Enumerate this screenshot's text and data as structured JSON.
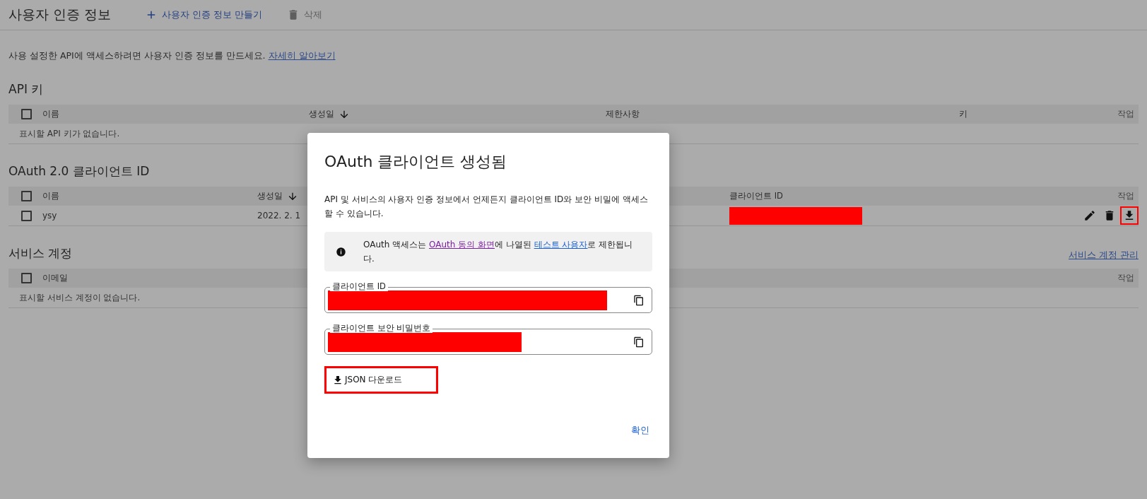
{
  "page": {
    "title": "사용자 인증 정보"
  },
  "toolbar": [
    {
      "kind": "create",
      "label": "사용자 인증 정보 만들기",
      "disabled": false
    },
    {
      "kind": "delete",
      "label": "삭제",
      "disabled": true
    }
  ],
  "intro": {
    "text": "사용 설정한 API에 액세스하려면 사용자 인증 정보를 만드세요.",
    "link": "자세히 알아보기"
  },
  "sections": [
    {
      "kind": "api_keys",
      "title": "API 키",
      "header_checked": false,
      "columns": [
        {
          "label": "이름",
          "sorted": false
        },
        {
          "label": "생성일",
          "sorted": true
        },
        {
          "label": "제한사항",
          "sorted": false
        },
        {
          "label": "키",
          "sorted": false
        },
        {
          "label": "작업",
          "sorted": false
        }
      ],
      "empty": "표시할 API 키가 없습니다."
    },
    {
      "kind": "oauth",
      "title": "OAuth 2.0 클라이언트 ID",
      "header_checked": false,
      "columns": [
        {
          "label": "이름",
          "sorted": false
        },
        {
          "label": "생성일",
          "sorted": true
        },
        {
          "label": "클라이언트 ID",
          "sorted": false
        },
        {
          "label": "작업",
          "sorted": false
        }
      ],
      "rows": [
        {
          "checked": false,
          "name": "ysy",
          "created": "2022. 2. 1",
          "client_id_redacted": true,
          "actions": [
            {
              "kind": "edit",
              "highlighted": false
            },
            {
              "kind": "delete",
              "highlighted": false
            },
            {
              "kind": "download",
              "highlighted": true
            }
          ]
        }
      ]
    },
    {
      "kind": "service_accounts",
      "title": "서비스 계정",
      "link": "서비스 계정 관리",
      "header_checked": false,
      "columns": [
        {
          "label": "이메일",
          "sorted": false
        },
        {
          "label": "작업",
          "sorted": false
        }
      ],
      "empty": "표시할 서비스 계정이 없습니다."
    }
  ],
  "dialog": {
    "title": "OAuth 클라이언트 생성됨",
    "description": "API 및 서비스의 사용자 인증 정보에서 언제든지 클라이언트 ID와 보안 비밀에 액세스할 수 있습니다.",
    "notice": [
      {
        "kind": "text",
        "text": "OAuth 액세스는 "
      },
      {
        "kind": "link",
        "text": "OAuth 동의 화면",
        "visited": true
      },
      {
        "kind": "text",
        "text": "에 나열된 "
      },
      {
        "kind": "link",
        "text": "테스트 사용자",
        "visited": false
      },
      {
        "kind": "text",
        "text": "로 제한됩니다."
      }
    ],
    "fields": [
      {
        "label": "클라이언트 ID",
        "redacted": true
      },
      {
        "label": "클라이언트 보안 비밀번호",
        "redacted": true
      }
    ],
    "download": {
      "label": "JSON 다운로드",
      "highlighted": true
    },
    "confirm": "확인"
  }
}
